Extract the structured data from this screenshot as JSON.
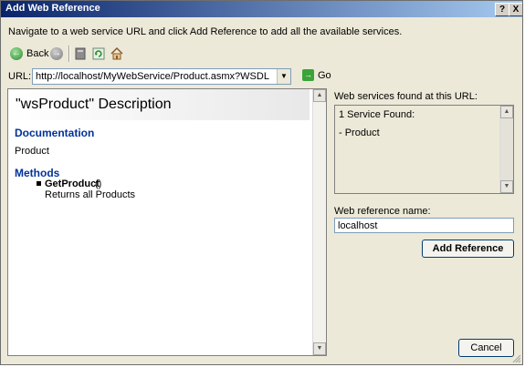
{
  "window": {
    "title": "Add Web Reference",
    "help_label": "?",
    "close_label": "X"
  },
  "instructions": "Navigate to a web service URL and click Add Reference to add all the available services.",
  "toolbar": {
    "back_label": "Back",
    "back_icon": "←",
    "forward_icon": "→",
    "stop_icon": "stop-icon",
    "refresh_icon": "refresh-icon",
    "home_icon": "home-icon"
  },
  "url": {
    "label": "URL:",
    "value": "http://localhost/MyWebService/Product.asmx?WSDL",
    "dropdown_icon": "▼",
    "go_label": "Go",
    "go_icon": "→"
  },
  "browser": {
    "title": "\"wsProduct\" Description",
    "documentation_heading": "Documentation",
    "service_name": "Product",
    "methods_heading": "Methods",
    "methods": [
      {
        "name": "GetProduct",
        "paren": "()",
        "description": "Returns all Products"
      }
    ],
    "scroll_up": "▲",
    "scroll_down": "▼"
  },
  "services_panel": {
    "label": "Web services found at this URL:",
    "line1": "1 Service Found:",
    "line2": "- Product",
    "scroll_up": "▲",
    "scroll_down": "▼"
  },
  "reference": {
    "label": "Web reference name:",
    "value": "localhost"
  },
  "buttons": {
    "add_reference": "Add Reference",
    "cancel": "Cancel"
  },
  "colors": {
    "titlebar_start": "#0a246a",
    "titlebar_end": "#a6caf0",
    "heading_blue": "#003399",
    "dialog_bg": "#ece9d8"
  }
}
